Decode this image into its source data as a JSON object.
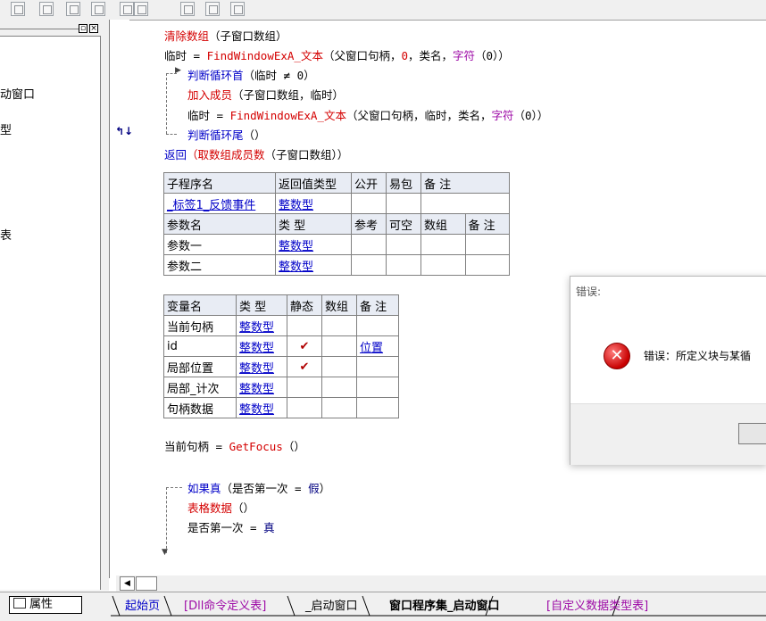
{
  "left_panel": {
    "items": [
      "动窗口",
      "型",
      "表"
    ],
    "win_btns": [
      "▫",
      "×"
    ]
  },
  "code": {
    "line1": {
      "fn": "清除数组",
      "args": "（子窗口数组）"
    },
    "line2": {
      "lhs": "临时",
      "op": " = ",
      "fn": "FindWindowExA_文本",
      "args_a": "（父窗口句柄，",
      "zero": "0",
      "args_b": "，类名，",
      "fn2": "字符",
      "args_c": "（0））"
    },
    "line3": {
      "kw": "判断循环首",
      "args": "（临时 ≠ 0）"
    },
    "line4": {
      "fn": "加入成员",
      "args": "（子窗口数组，临时）"
    },
    "line5": {
      "lhs": "临时",
      "op": " = ",
      "fn": "FindWindowExA_文本",
      "args_a": "（父窗口句柄，临时，类名，",
      "fn2": "字符",
      "args_c": "（0））"
    },
    "line6": {
      "kw": "判断循环尾",
      "args": "（）"
    },
    "line7": {
      "kw": "返回",
      "fn": "（取数组成员数",
      "args": "（子窗口数组））"
    },
    "line8": {
      "lhs": "当前句柄",
      "op": " = ",
      "fn": "GetFocus",
      "args": "（）"
    },
    "line9": {
      "kw": "如果真",
      "args_a": "（是否第一次",
      "op": " = ",
      "val": "假",
      "args_b": "）"
    },
    "line10": {
      "fn": "表格数据",
      "args": "（）"
    },
    "line11": {
      "lhs": "是否第一次",
      "op": " = ",
      "val": "真"
    }
  },
  "sub_table": {
    "headers": [
      "子程序名",
      "返回值类型",
      "公开",
      "易包",
      "备 注"
    ],
    "row": [
      "_标签1_反馈事件",
      "整数型"
    ],
    "param_headers": [
      "参数名",
      "类 型",
      "参考",
      "可空",
      "数组",
      "备 注"
    ],
    "params": [
      [
        "参数一",
        "整数型"
      ],
      [
        "参数二",
        "整数型"
      ]
    ]
  },
  "var_table": {
    "headers": [
      "变量名",
      "类 型",
      "静态",
      "数组",
      "备 注"
    ],
    "rows": [
      {
        "name": "当前句柄",
        "type": "整数型",
        "static": "",
        "note": ""
      },
      {
        "name": "id",
        "type": "整数型",
        "static": "✔",
        "note": "位置"
      },
      {
        "name": "局部位置",
        "type": "整数型",
        "static": "✔",
        "note": ""
      },
      {
        "name": "局部_计次",
        "type": "整数型",
        "static": "",
        "note": ""
      },
      {
        "name": "句柄数据",
        "type": "整数型",
        "static": "",
        "note": ""
      }
    ]
  },
  "dialog": {
    "title": "错误:",
    "message": "错误：所定义块与某循"
  },
  "tabs": {
    "properties": "属性",
    "items": [
      "起始页",
      "[Dll命令定义表]",
      "_启动窗口",
      "窗口程序集_启动窗口",
      "[自定义数据类型表]"
    ]
  },
  "gutter_marker": "↰↓"
}
